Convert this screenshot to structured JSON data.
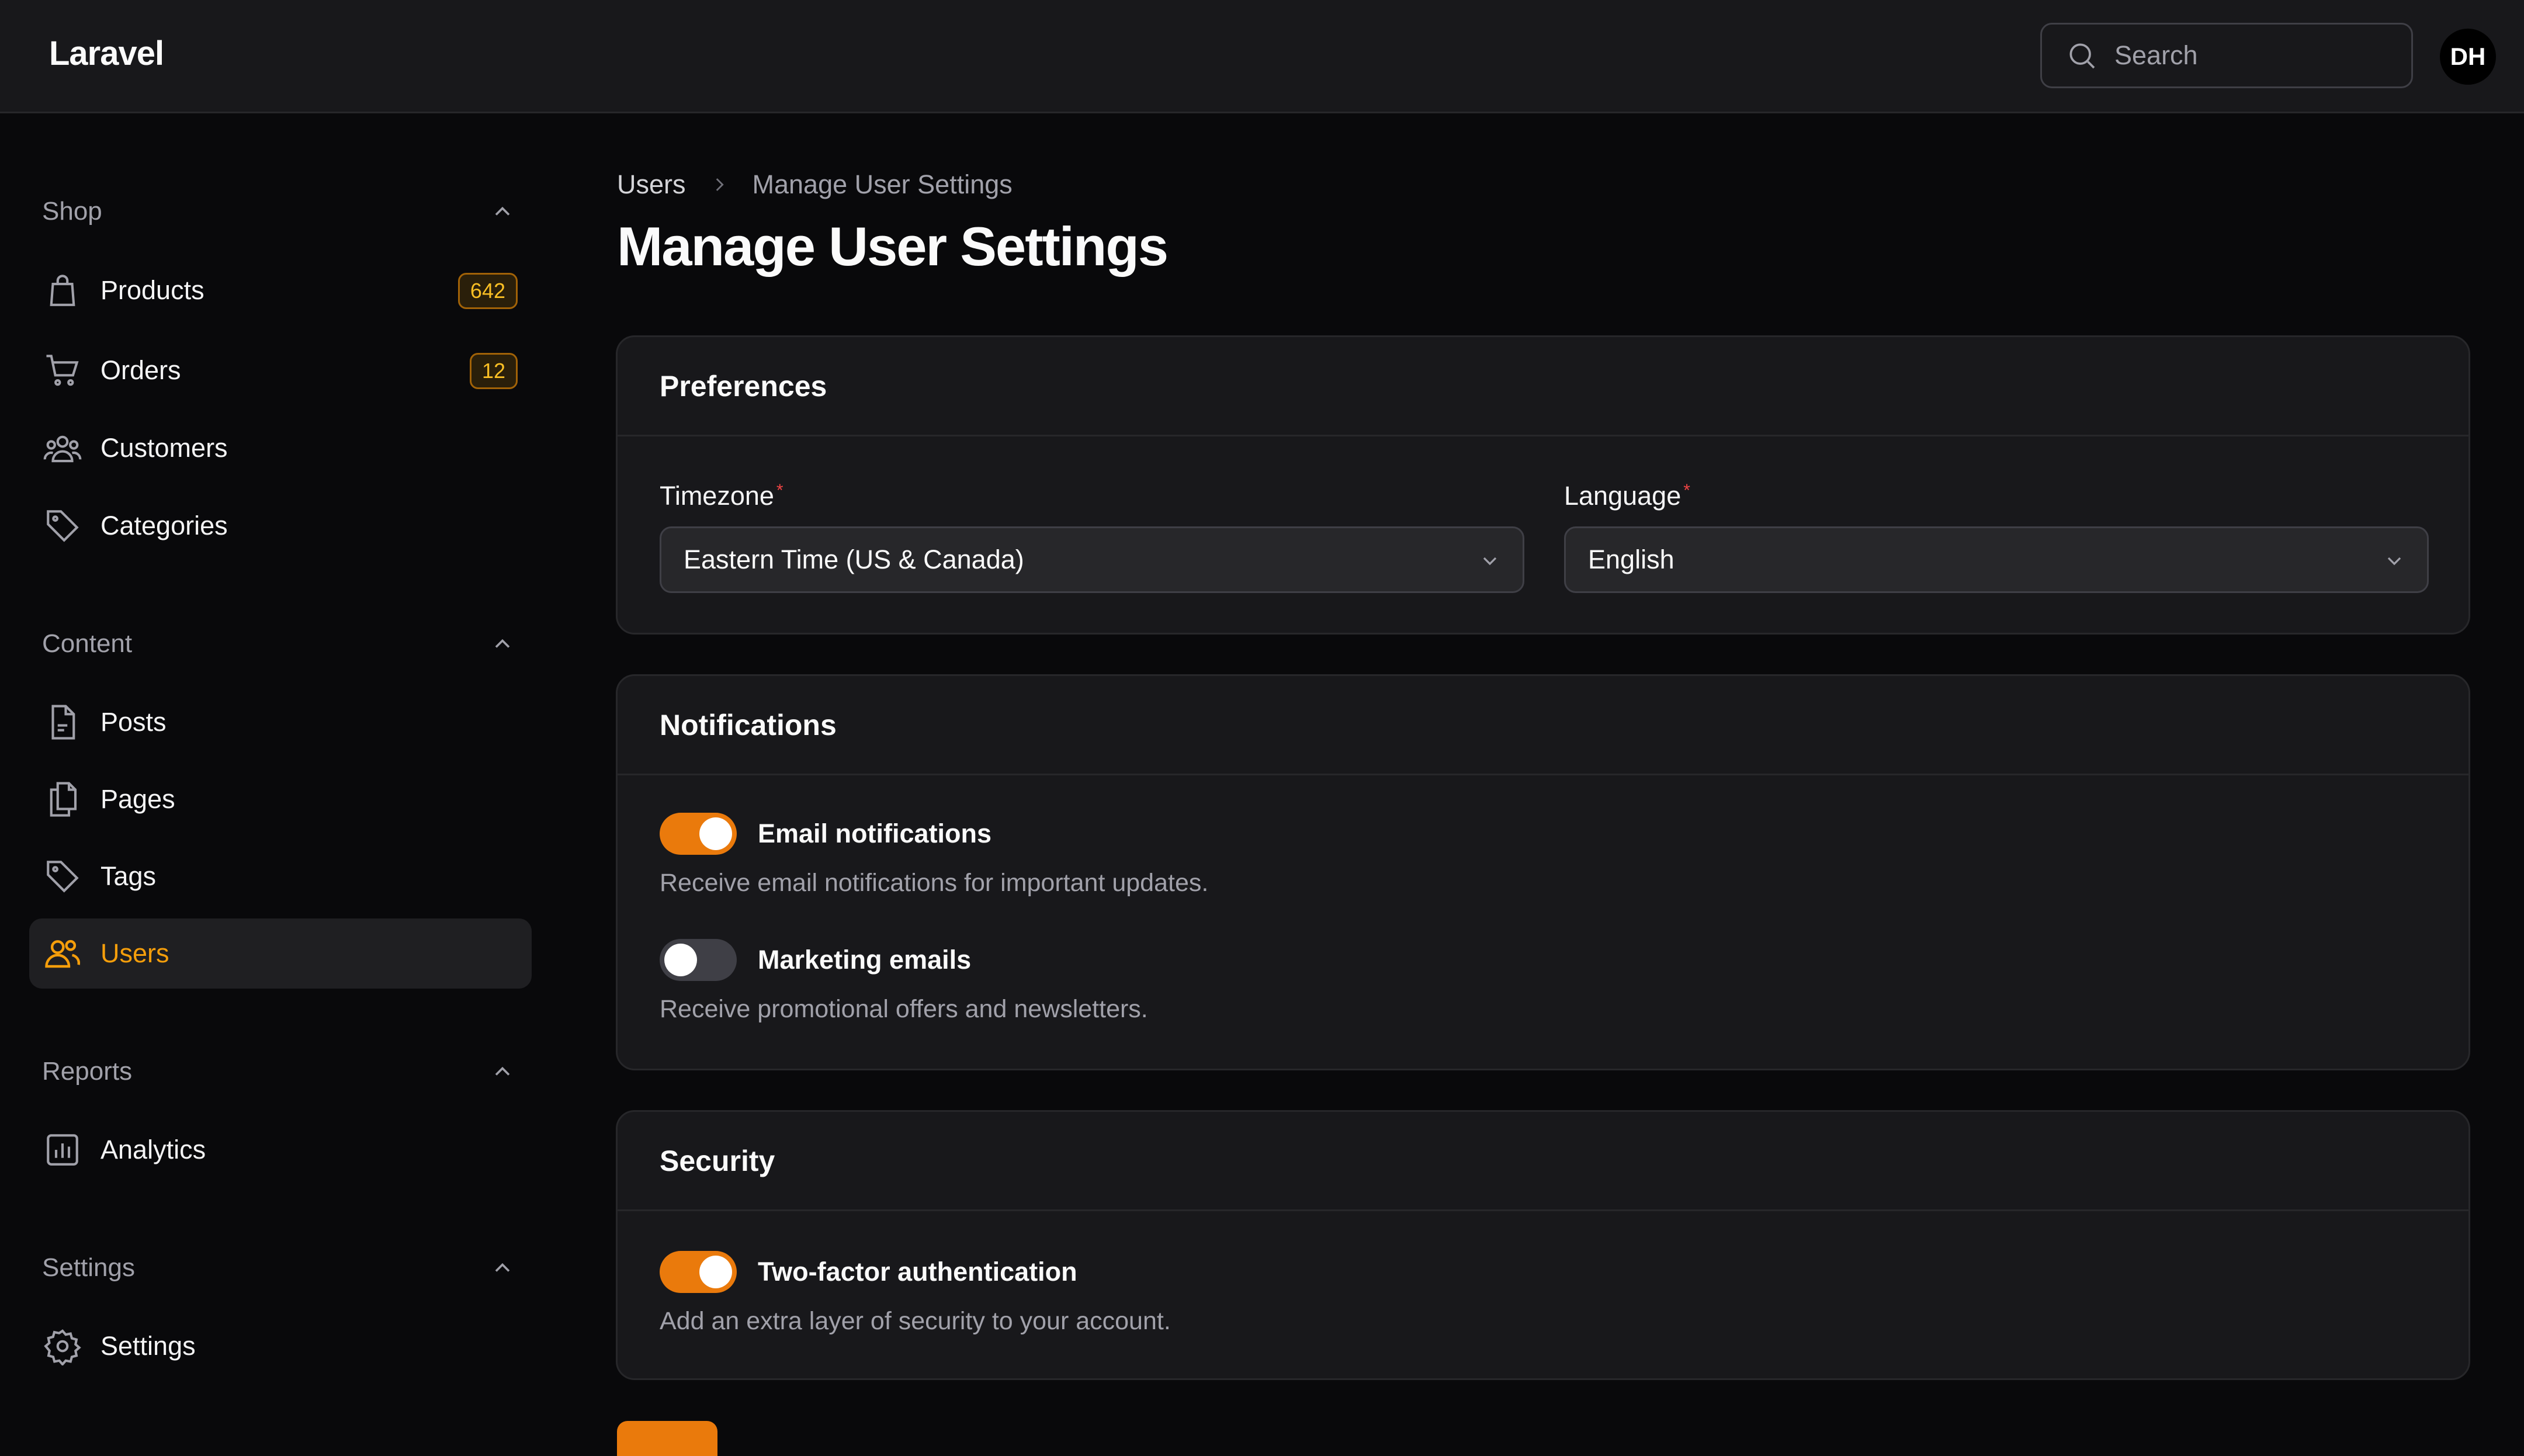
{
  "app": {
    "brand": "Laravel"
  },
  "search": {
    "placeholder": "Search"
  },
  "user": {
    "initials": "DH"
  },
  "sidebar": {
    "groups": [
      {
        "label": "Shop",
        "items": [
          {
            "label": "Products",
            "icon": "shopping-bag-icon",
            "badge": "642"
          },
          {
            "label": "Orders",
            "icon": "shopping-cart-icon",
            "badge": "12"
          },
          {
            "label": "Customers",
            "icon": "user-group-icon"
          },
          {
            "label": "Categories",
            "icon": "tag-icon"
          }
        ]
      },
      {
        "label": "Content",
        "items": [
          {
            "label": "Posts",
            "icon": "document-icon"
          },
          {
            "label": "Pages",
            "icon": "documents-icon"
          },
          {
            "label": "Tags",
            "icon": "tag-icon"
          },
          {
            "label": "Users",
            "icon": "users-icon",
            "active": true
          }
        ]
      },
      {
        "label": "Reports",
        "items": [
          {
            "label": "Analytics",
            "icon": "chart-bar-icon"
          }
        ]
      },
      {
        "label": "Settings",
        "items": [
          {
            "label": "Settings",
            "icon": "cog-icon"
          }
        ]
      }
    ]
  },
  "breadcrumb": {
    "parent": "Users",
    "current": "Manage User Settings"
  },
  "page": {
    "title": "Manage User Settings"
  },
  "preferences": {
    "title": "Preferences",
    "timezone": {
      "label": "Timezone",
      "value": "Eastern Time (US & Canada)"
    },
    "language": {
      "label": "Language",
      "value": "English"
    }
  },
  "notifications": {
    "title": "Notifications",
    "email": {
      "label": "Email notifications",
      "description": "Receive email notifications for important updates.",
      "enabled": true
    },
    "marketing": {
      "label": "Marketing emails",
      "description": "Receive promotional offers and newsletters.",
      "enabled": false
    }
  },
  "security": {
    "title": "Security",
    "two_factor": {
      "label": "Two-factor authentication",
      "description": "Add an extra layer of security to your account.",
      "enabled": true
    }
  },
  "colors": {
    "accent": "#ea7a0c",
    "active_nav": "#f59e0b",
    "badge_text": "#fbbf24",
    "required": "#ef4444"
  }
}
